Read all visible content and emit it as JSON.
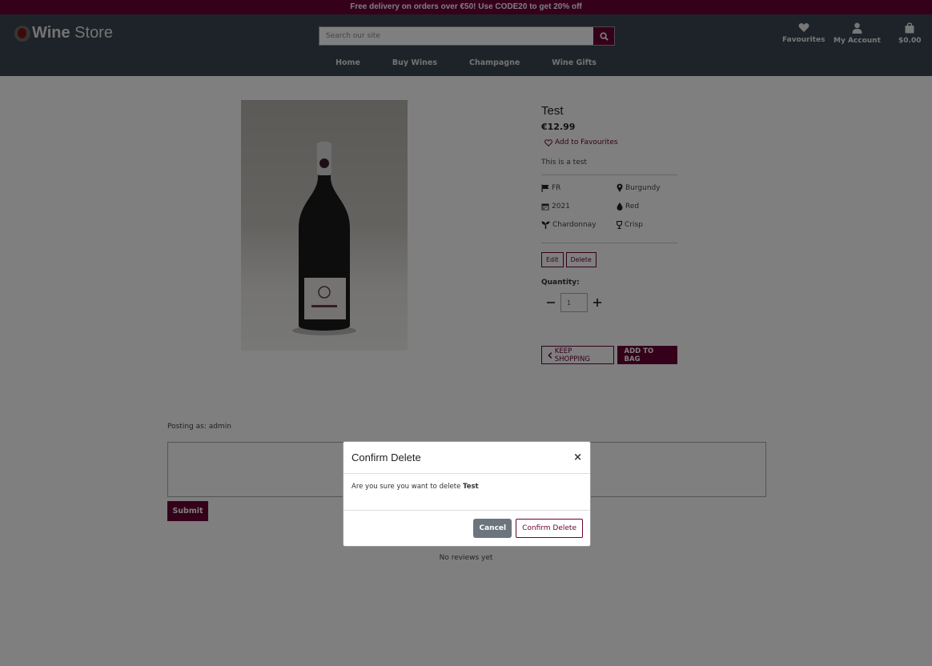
{
  "promo": "Free delivery on orders over €50!  Use CODE20 to get 20% off",
  "header": {
    "logo_bold": "Wine",
    "logo_light": " Store",
    "search_placeholder": "Search our site",
    "actions": {
      "favourites": "Favourites",
      "account": "My Account",
      "bag_total": "$0.00"
    },
    "nav": [
      "Home",
      "Buy Wines",
      "Champagne",
      "Wine Gifts"
    ]
  },
  "product": {
    "image_icon": "wine-bottle",
    "title": "Test",
    "price": "€12.99",
    "add_to_favourites": "Add to Favourites",
    "description": "This is a test",
    "attributes": {
      "country": "FR",
      "region": "Burgundy",
      "year": "2021",
      "colour": "Red",
      "grape": "Chardonnay",
      "style": "Crisp"
    },
    "edit_label": "Edit",
    "delete_label": "Delete",
    "quantity_label": "Quantity:",
    "quantity_value": "1",
    "keep_shopping": "Keep Shopping",
    "add_to_bag": "Add to Bag"
  },
  "reviews": {
    "posting_as": "Posting as: admin",
    "submit": "Submit",
    "empty": "No reviews yet"
  },
  "modal": {
    "title": "Confirm Delete",
    "close": "×",
    "body_prefix": "Are you sure you want to delete ",
    "body_item": "Test",
    "cancel": "Cancel",
    "confirm": "Confirm Delete"
  },
  "colors": {
    "brand": "#6a0035",
    "header_bg": "#3a4750",
    "overlay": "rgba(0,0,0,0.5)"
  }
}
